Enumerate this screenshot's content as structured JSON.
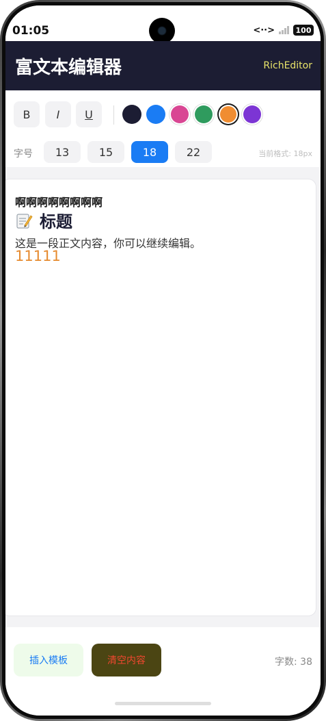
{
  "status_bar": {
    "time": "01:05",
    "data_icon": "<··>",
    "battery": "100"
  },
  "header": {
    "title": "富文本编辑器",
    "subtitle": "RichEditor"
  },
  "toolbar": {
    "bold_label": "B",
    "italic_label": "I",
    "underline_label": "U",
    "colors": [
      "#1c1d33",
      "#1a7cf4",
      "#d94693",
      "#2f9b5e",
      "#f08d32",
      "#7c35d4"
    ],
    "selected_color": "#f08d32",
    "size_label": "字号",
    "sizes": [
      "13",
      "15",
      "18",
      "22"
    ],
    "selected_size": "18",
    "format_info": "当前格式: 18px"
  },
  "editor": {
    "line1": "啊啊啊啊啊啊啊啊",
    "heading": "标题",
    "heading_icon": "memo-icon",
    "body": "这是一段正文内容，你可以继续编辑。",
    "colored_text": "11111"
  },
  "bottom_bar": {
    "insert_template": "插入模板",
    "clear_content": "清空内容",
    "word_count": "字数: 38"
  }
}
